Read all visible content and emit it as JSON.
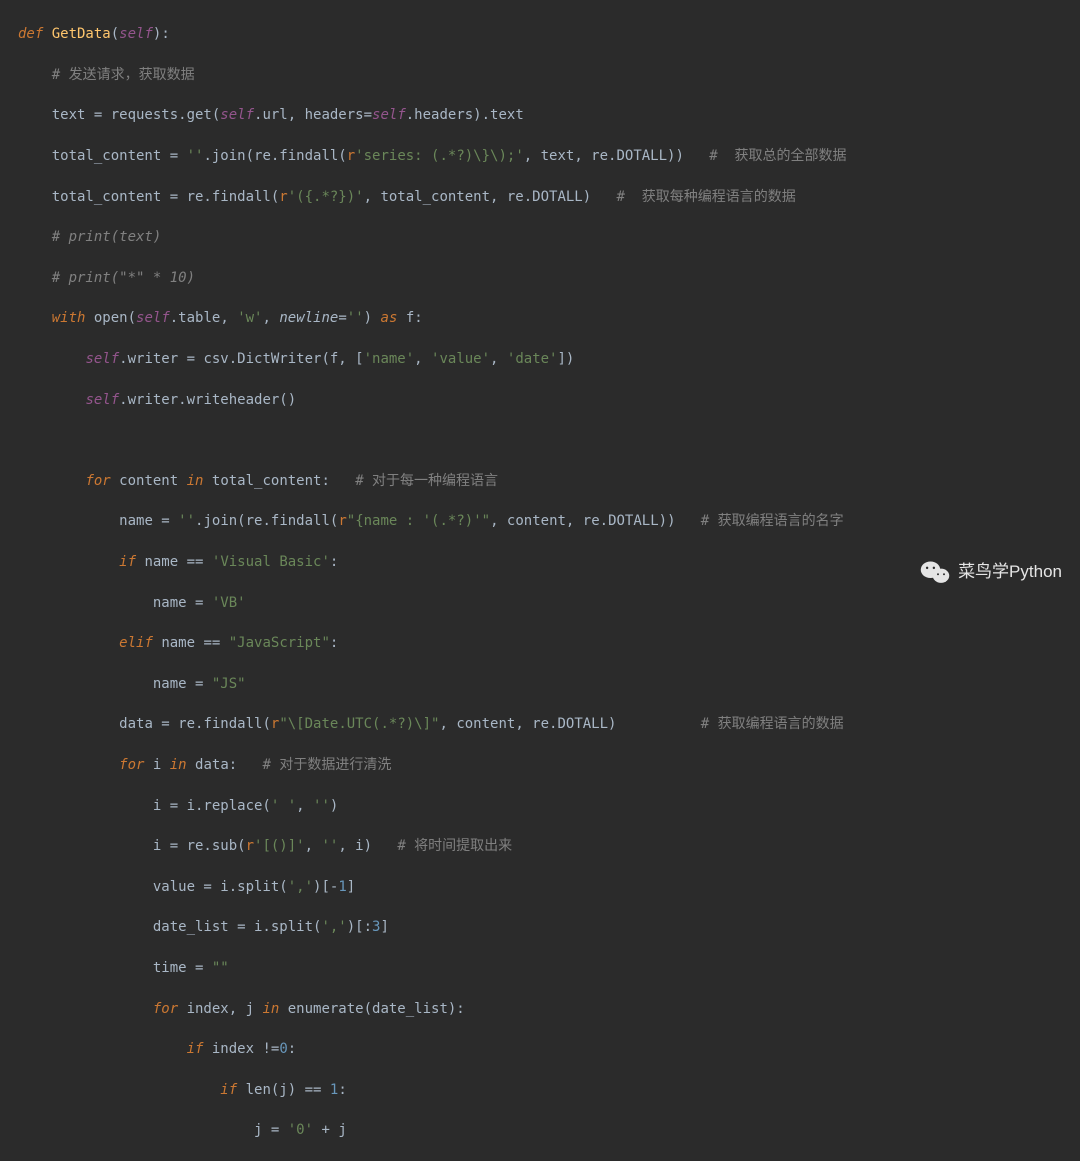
{
  "lines": {
    "l1": {
      "def": "def ",
      "name": "GetData",
      "sig": "(",
      "self": "self",
      "sig2": "):"
    },
    "l2": {
      "cmt": "# 发送请求，获取数据"
    },
    "l3": {
      "a": "text = requests.get(",
      "self1": "self",
      "b": ".url, headers=",
      "self2": "self",
      "c": ".headers).text"
    },
    "l4": {
      "a": "total_content = ",
      "s1": "''",
      "b": ".join(re.findall(",
      "r": "r",
      "s2": "'series: (.*?)\\}\\);'",
      "c": ", text, re.DOTALL))",
      "cmt": "#  获取总的全部数据"
    },
    "l5": {
      "a": "total_content = re.findall(",
      "r": "r",
      "s1": "'({.*?})'",
      "b": ", total_content, re.DOTALL)",
      "cmt": "#  获取每种编程语言的数据"
    },
    "l6": {
      "cmt": "# print(text)"
    },
    "l7": {
      "cmt": "# print(\"*\" * 10)"
    },
    "l8": {
      "kw1": "with ",
      "a": "open(",
      "self": "self",
      "b": ".table, ",
      "s1": "'w'",
      "c": ", ",
      "kw_nl": "newline",
      "eq": "=",
      "s2": "''",
      "d": ") ",
      "kw2": "as ",
      "e": "f:"
    },
    "l9": {
      "self": "self",
      "a": ".writer = csv.DictWriter(f, [",
      "s1": "'name'",
      "b": ", ",
      "s2": "'value'",
      "c": ", ",
      "s3": "'date'",
      "d": "])"
    },
    "l10": {
      "self": "self",
      "a": ".writer.writeheader()"
    },
    "l11": {},
    "l12": {
      "kw1": "for ",
      "a": "content ",
      "kw2": "in ",
      "b": "total_content:",
      "cmt": "# 对于每一种编程语言"
    },
    "l13": {
      "a": "name = ",
      "s1": "''",
      "b": ".join(re.findall(",
      "r": "r",
      "s2": "\"{name : '(.*?)'\"",
      "c": ", content, re.DOTALL))",
      "cmt": "# 获取编程语言的名字"
    },
    "l14": {
      "kw": "if ",
      "a": "name == ",
      "s": "'Visual Basic'",
      "b": ":"
    },
    "l15": {
      "a": "name = ",
      "s": "'VB'"
    },
    "l16": {
      "kw": "elif ",
      "a": "name == ",
      "s": "\"JavaScript\"",
      "b": ":"
    },
    "l17": {
      "a": "name = ",
      "s": "\"JS\""
    },
    "l18": {
      "a": "data = re.findall(",
      "r": "r",
      "s": "\"\\[Date.UTC(.*?)\\]\"",
      "b": ", content, re.DOTALL)",
      "cmt": "# 获取编程语言的数据"
    },
    "l19": {
      "kw1": "for ",
      "a": "i ",
      "kw2": "in ",
      "b": "data:",
      "cmt": "# 对于数据进行清洗"
    },
    "l20": {
      "a": "i = i.replace(",
      "s1": "' '",
      "b": ", ",
      "s2": "''",
      "c": ")"
    },
    "l21": {
      "a": "i = re.sub(",
      "r": "r",
      "s1": "'[()]'",
      "b": ", ",
      "s2": "''",
      "c": ", i)",
      "cmt": "# 将时间提取出来"
    },
    "l22": {
      "a": "value = i.split(",
      "s": "','",
      "b": ")[-",
      "n": "1",
      "c": "]"
    },
    "l23": {
      "a": "date_list = i.split(",
      "s": "','",
      "b": ")[:",
      "n": "3",
      "c": "]"
    },
    "l24": {
      "a": "time = ",
      "s": "\"\""
    },
    "l25": {
      "kw1": "for ",
      "a": "index, j ",
      "kw2": "in ",
      "b": "enumerate(date_list):"
    },
    "l26": {
      "kw": "if ",
      "a": "index !=",
      "n": "0",
      "b": ":"
    },
    "l27": {
      "kw": "if ",
      "a": "len(j) == ",
      "n": "1",
      "b": ":"
    },
    "l28": {
      "a": "j = ",
      "s": "'0'",
      "b": " + j"
    }
  },
  "watermark": {
    "text": "菜鸟学Python"
  }
}
